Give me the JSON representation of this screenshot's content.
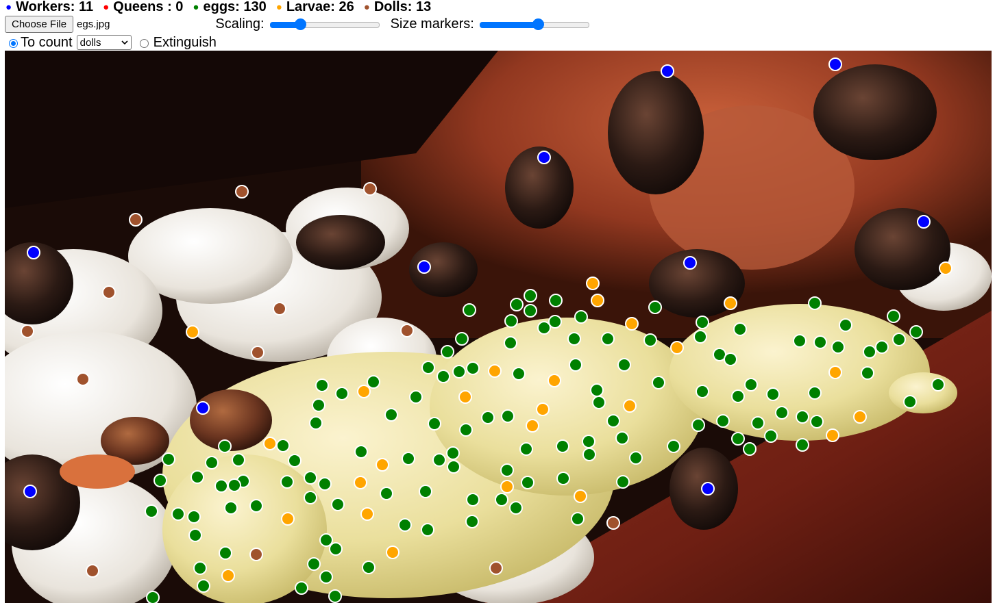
{
  "legend": [
    {
      "label": "Workers: 11",
      "color": "#0000ff"
    },
    {
      "label": "Queens : 0",
      "color": "#ff0000"
    },
    {
      "label": "eggs: 130",
      "color": "#008000"
    },
    {
      "label": "Larvae: 26",
      "color": "#ffa500"
    },
    {
      "label": "Dolls: 13",
      "color": "#a0522d"
    }
  ],
  "controls": {
    "file_button": "Choose File",
    "file_name": "egs.jpg",
    "scaling_label": "Scaling:",
    "scaling_value": 0.28,
    "size_label": "Size markers:",
    "size_value": 0.53,
    "count_label": "To count",
    "count_selected": "dolls",
    "extinguish_label": "Extinguish"
  },
  "markers": {
    "workers": [
      [
        967,
        30
      ],
      [
        1212,
        20
      ],
      [
        787,
        156
      ],
      [
        1341,
        250
      ],
      [
        42,
        295
      ],
      [
        612,
        316
      ],
      [
        1000,
        310
      ],
      [
        289,
        522
      ],
      [
        37,
        644
      ],
      [
        1026,
        640
      ]
    ],
    "dolls": [
      [
        346,
        206
      ],
      [
        533,
        202
      ],
      [
        191,
        247
      ],
      [
        152,
        353
      ],
      [
        401,
        377
      ],
      [
        33,
        410
      ],
      [
        587,
        409
      ],
      [
        369,
        441
      ],
      [
        114,
        480
      ],
      [
        888,
        690
      ],
      [
        367,
        736
      ],
      [
        128,
        760
      ],
      [
        717,
        756
      ]
    ],
    "larvae": [
      [
        858,
        340
      ],
      [
        865,
        365
      ],
      [
        915,
        399
      ],
      [
        1059,
        369
      ],
      [
        1373,
        318
      ],
      [
        274,
        411
      ],
      [
        981,
        434
      ],
      [
        715,
        468
      ],
      [
        802,
        482
      ],
      [
        524,
        498
      ],
      [
        672,
        506
      ],
      [
        1212,
        470
      ],
      [
        785,
        524
      ],
      [
        912,
        519
      ],
      [
        1248,
        535
      ],
      [
        770,
        548
      ],
      [
        387,
        574
      ],
      [
        1208,
        562
      ],
      [
        551,
        605
      ],
      [
        733,
        637
      ],
      [
        519,
        631
      ],
      [
        840,
        651
      ],
      [
        413,
        684
      ],
      [
        529,
        677
      ],
      [
        566,
        733
      ],
      [
        326,
        767
      ]
    ],
    "eggs": [
      [
        767,
        358
      ],
      [
        678,
        379
      ],
      [
        747,
        371
      ],
      [
        804,
        365
      ],
      [
        767,
        380
      ],
      [
        739,
        395
      ],
      [
        803,
        396
      ],
      [
        787,
        405
      ],
      [
        841,
        389
      ],
      [
        949,
        375
      ],
      [
        1018,
        397
      ],
      [
        1182,
        369
      ],
      [
        1073,
        407
      ],
      [
        1227,
        401
      ],
      [
        1297,
        388
      ],
      [
        1330,
        411
      ],
      [
        667,
        421
      ],
      [
        738,
        427
      ],
      [
        831,
        421
      ],
      [
        880,
        421
      ],
      [
        942,
        423
      ],
      [
        1015,
        418
      ],
      [
        1160,
        424
      ],
      [
        1190,
        426
      ],
      [
        1216,
        433
      ],
      [
        1280,
        433
      ],
      [
        1305,
        422
      ],
      [
        646,
        440
      ],
      [
        1043,
        444
      ],
      [
        1059,
        451
      ],
      [
        1262,
        440
      ],
      [
        618,
        463
      ],
      [
        640,
        476
      ],
      [
        663,
        469
      ],
      [
        683,
        464
      ],
      [
        750,
        472
      ],
      [
        833,
        459
      ],
      [
        904,
        459
      ],
      [
        1259,
        471
      ],
      [
        538,
        484
      ],
      [
        954,
        485
      ],
      [
        1089,
        488
      ],
      [
        463,
        489
      ],
      [
        492,
        501
      ],
      [
        600,
        506
      ],
      [
        864,
        496
      ],
      [
        867,
        514
      ],
      [
        1018,
        498
      ],
      [
        1070,
        505
      ],
      [
        1121,
        502
      ],
      [
        1182,
        500
      ],
      [
        458,
        518
      ],
      [
        564,
        532
      ],
      [
        627,
        545
      ],
      [
        705,
        536
      ],
      [
        734,
        534
      ],
      [
        888,
        541
      ],
      [
        1012,
        547
      ],
      [
        1048,
        541
      ],
      [
        1099,
        544
      ],
      [
        1134,
        529
      ],
      [
        1164,
        535
      ],
      [
        1185,
        542
      ],
      [
        1321,
        513
      ],
      [
        1362,
        488
      ],
      [
        454,
        544
      ],
      [
        673,
        554
      ],
      [
        901,
        566
      ],
      [
        1070,
        567
      ],
      [
        1118,
        563
      ],
      [
        406,
        577
      ],
      [
        321,
        578
      ],
      [
        761,
        582
      ],
      [
        814,
        578
      ],
      [
        852,
        571
      ],
      [
        976,
        578
      ],
      [
        1087,
        582
      ],
      [
        1164,
        576
      ],
      [
        853,
        590
      ],
      [
        654,
        588
      ],
      [
        520,
        586
      ],
      [
        589,
        596
      ],
      [
        239,
        597
      ],
      [
        302,
        602
      ],
      [
        341,
        598
      ],
      [
        423,
        599
      ],
      [
        634,
        598
      ],
      [
        655,
        608
      ],
      [
        733,
        613
      ],
      [
        921,
        595
      ],
      [
        281,
        623
      ],
      [
        227,
        628
      ],
      [
        348,
        629
      ],
      [
        335,
        635
      ],
      [
        316,
        636
      ],
      [
        412,
        630
      ],
      [
        446,
        624
      ],
      [
        467,
        633
      ],
      [
        614,
        644
      ],
      [
        763,
        631
      ],
      [
        815,
        625
      ],
      [
        557,
        647
      ],
      [
        902,
        630
      ],
      [
        214,
        673
      ],
      [
        253,
        677
      ],
      [
        276,
        681
      ],
      [
        330,
        668
      ],
      [
        367,
        665
      ],
      [
        446,
        653
      ],
      [
        486,
        663
      ],
      [
        683,
        656
      ],
      [
        725,
        656
      ],
      [
        746,
        668
      ],
      [
        278,
        708
      ],
      [
        584,
        693
      ],
      [
        617,
        700
      ],
      [
        682,
        688
      ],
      [
        836,
        684
      ],
      [
        469,
        715
      ],
      [
        483,
        728
      ],
      [
        322,
        734
      ],
      [
        285,
        756
      ],
      [
        451,
        750
      ],
      [
        531,
        755
      ],
      [
        469,
        769
      ],
      [
        290,
        782
      ],
      [
        433,
        785
      ],
      [
        482,
        797
      ],
      [
        216,
        799
      ]
    ]
  }
}
